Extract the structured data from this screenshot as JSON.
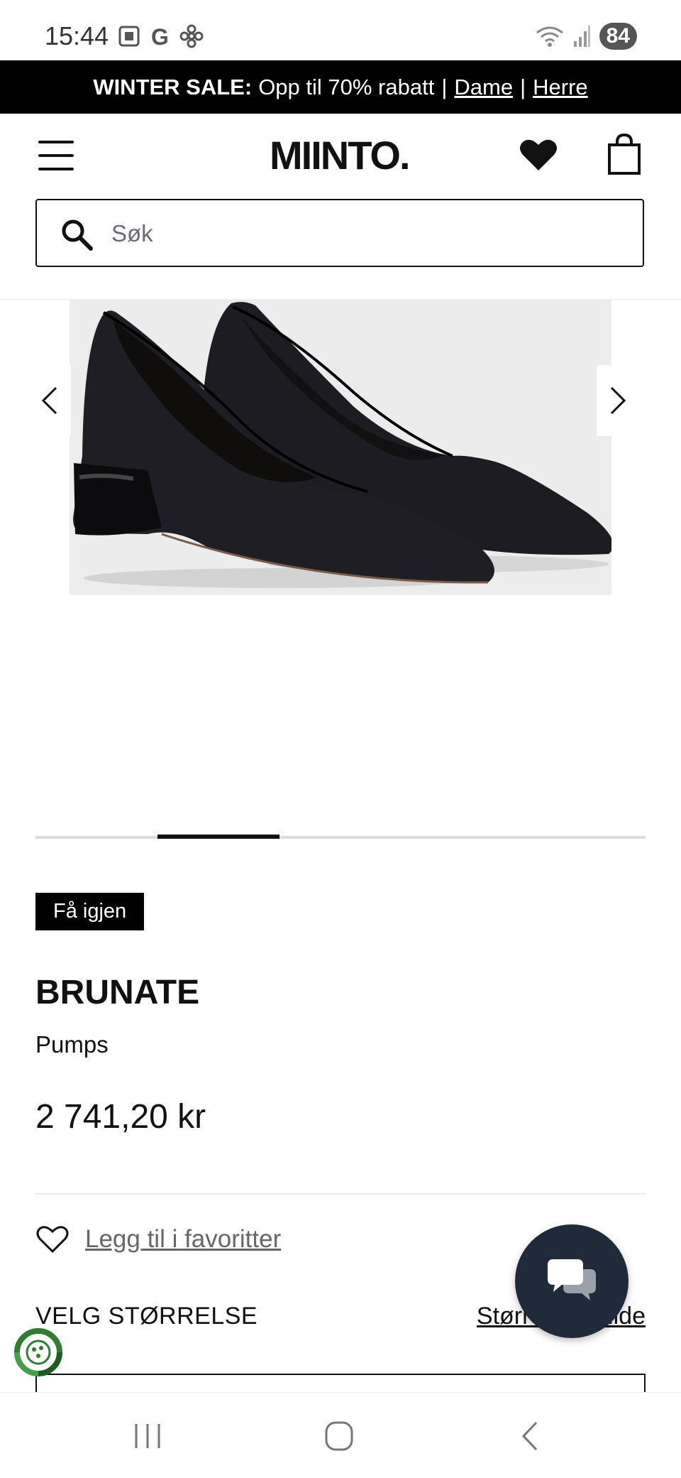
{
  "status_bar": {
    "time": "15:44",
    "battery": "84",
    "icons": [
      "screenshot-icon",
      "google-icon",
      "pinwheel-icon",
      "wifi-icon",
      "signal-icon"
    ]
  },
  "promo": {
    "bold": "WINTER SALE:",
    "text": "Opp til 70% rabatt",
    "link_women": "Dame",
    "link_men": "Herre"
  },
  "header": {
    "logo": "MIINTO."
  },
  "search": {
    "placeholder": "Søk"
  },
  "gallery": {
    "current_index": 2,
    "total": 5
  },
  "product": {
    "badge": "Få igjen",
    "brand": "BRUNATE",
    "category": "Pumps",
    "price": "2 741,20 kr",
    "favorite_label": "Legg til i favoritter",
    "size_label": "VELG STØRRELSE",
    "size_guide": "Størrelsesguide"
  },
  "colors": {
    "accent": "#000000",
    "chat_button": "#1f2a3a",
    "eco_icon": "#2e7d32"
  }
}
